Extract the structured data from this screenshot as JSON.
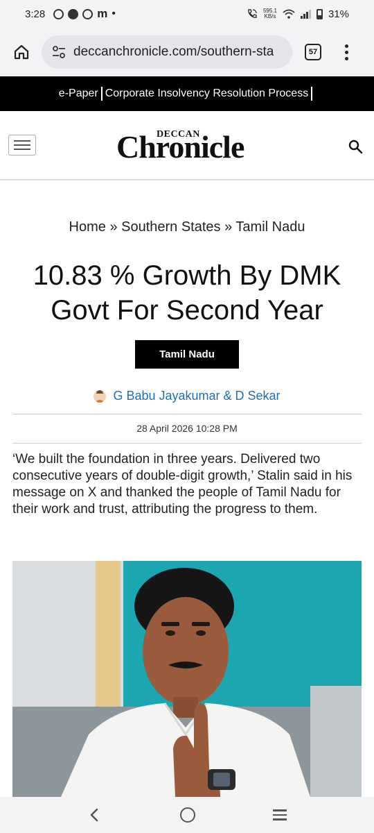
{
  "status_bar": {
    "time": "3:28",
    "net_speed_value": "595.1",
    "net_speed_unit": "KB/s",
    "battery": "31%",
    "icons": [
      "whatsapp-icon",
      "chat-icon",
      "whatsapp-icon",
      "m-icon",
      "dot",
      "wifi-call-icon",
      "wifi-icon",
      "signal-icon",
      "battery-icon"
    ],
    "m_label": "m",
    "dot_label": "•"
  },
  "browser": {
    "url": "deccanchronicle.com/southern-sta",
    "tab_count": "57"
  },
  "topic_strip": {
    "items": [
      "e-Paper",
      "Corporate Insolvency Resolution Process"
    ]
  },
  "header": {
    "logo_top": "DECCAN",
    "logo_main": "Chronicle"
  },
  "breadcrumb": {
    "text": "Home » Southern States » Tamil Nadu"
  },
  "article": {
    "title": "10.83 % Growth By DMK Govt For Second Year",
    "category": "Tamil Nadu",
    "author": "G Babu Jayakumar & D Sekar",
    "date": "28 April 2026 10:28 PM",
    "summary": "‘We built the foundation in three years. Delivered two consecutive years of double-digit growth,’ Stalin said in his message on X and thanked the people of Tamil Nadu for their work and trust, attributing the progress to them."
  },
  "colors": {
    "accent_link": "#1f6fb2",
    "strip_bg": "#000000",
    "chrome_bg": "#f3f3f6",
    "photo_backdrop": "#1ba6b0"
  }
}
